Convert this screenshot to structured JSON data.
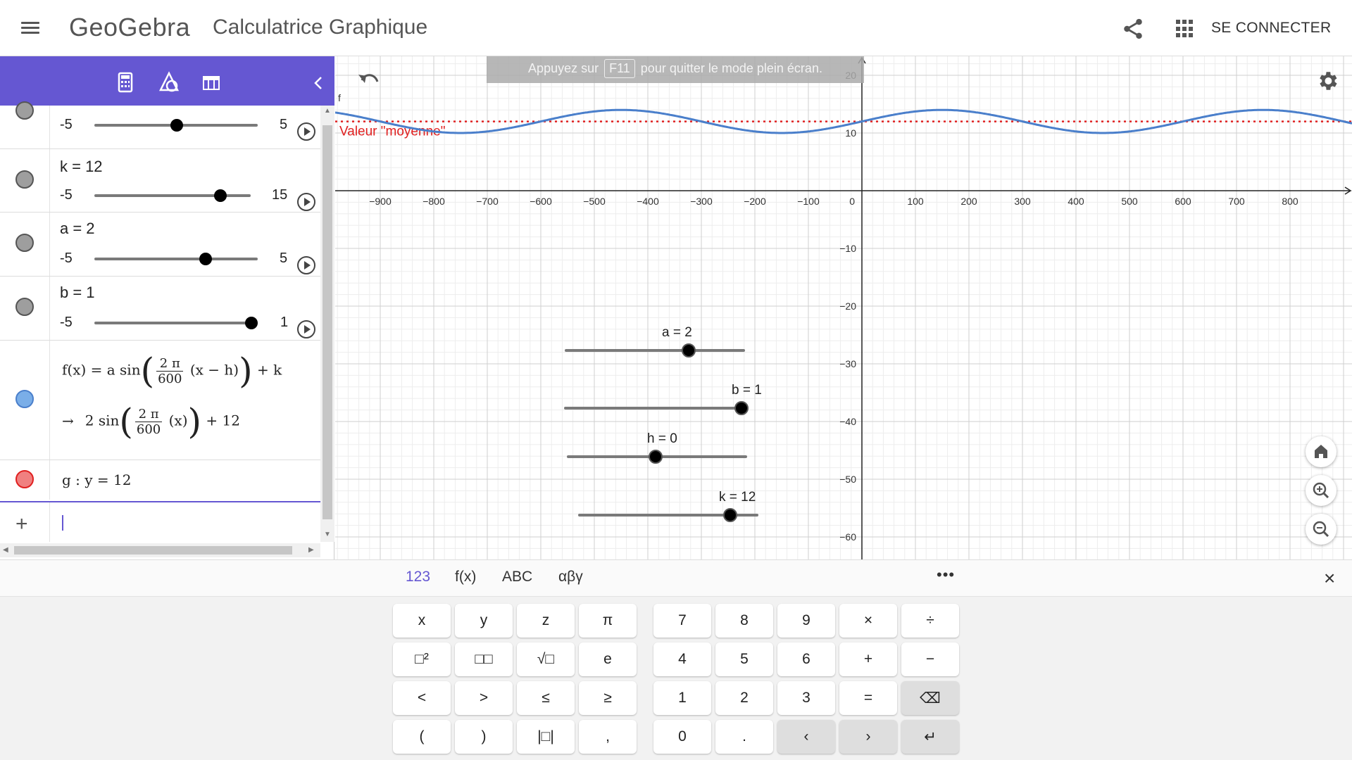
{
  "header": {
    "logo": "GeoGebra",
    "app_title": "Calculatrice Graphique",
    "login_label": "SE CONNECTER"
  },
  "fullscreen_notice": {
    "before": "Appuyez sur",
    "key": "F11",
    "after": "pour quitter le mode plein écran."
  },
  "algebra": {
    "rows": [
      {
        "label": "",
        "min": "-5",
        "max": "5",
        "value": 0,
        "color": "#9e9e9e"
      },
      {
        "label": "k = 12",
        "min": "-5",
        "max": "15",
        "value": 12,
        "color": "#9e9e9e"
      },
      {
        "label": "a = 2",
        "min": "-5",
        "max": "5",
        "value": 2,
        "color": "#9e9e9e"
      },
      {
        "label": "b = 1",
        "min": "-5",
        "max": "1",
        "value": 1,
        "color": "#9e9e9e"
      }
    ],
    "function_row": {
      "lhs": "f(x) = a  sin",
      "frac_num": "2 π",
      "frac_den": "600",
      "args": "(x − h)",
      "tail": "+ k",
      "arrow": "→",
      "result_pre": "2  sin",
      "result_args": "(x)",
      "result_tail": "+ 12",
      "color": "#7aaee8"
    },
    "line_row": {
      "text": "g : y = 12",
      "color": "#f08080"
    }
  },
  "graph": {
    "x_ticks": [
      -900,
      -800,
      -700,
      -600,
      -500,
      -400,
      -300,
      -200,
      -100,
      100,
      200,
      300,
      400,
      500,
      600,
      700,
      800
    ],
    "y_ticks": [
      20,
      10,
      -10,
      -20,
      -30,
      -40,
      -50,
      -60
    ],
    "origin_label": "0",
    "f_label": "f",
    "g_label": "Valeur \"moyenne\"",
    "function": {
      "a": 2,
      "b": 1,
      "h": 0,
      "k": 12,
      "period": 600
    },
    "line_y": 12,
    "colors": {
      "function": "#4a7fcb",
      "line": "#e02020"
    },
    "sliders": [
      {
        "label": "a = 2",
        "value": 2,
        "min": -5,
        "max": 5
      },
      {
        "label": "b = 1",
        "value": 1,
        "min": -5,
        "max": 1
      },
      {
        "label": "h = 0",
        "value": 0,
        "min": -5,
        "max": 5
      },
      {
        "label": "k = 12",
        "value": 12,
        "min": -5,
        "max": 15
      }
    ]
  },
  "keyboard": {
    "tabs": [
      "123",
      "f(x)",
      "ABC",
      "αβγ"
    ],
    "more": "•••",
    "close": "×",
    "left_keys": [
      [
        "x",
        "y",
        "z",
        "π"
      ],
      [
        "□²",
        "□□",
        "√□",
        "e"
      ],
      [
        "<",
        ">",
        "≤",
        "≥"
      ],
      [
        "(",
        ")",
        "|□|",
        ","
      ]
    ],
    "right_keys": [
      [
        "7",
        "8",
        "9",
        "×",
        "÷"
      ],
      [
        "4",
        "5",
        "6",
        "+",
        "−"
      ],
      [
        "1",
        "2",
        "3",
        "=",
        "⌫"
      ],
      [
        "0",
        ".",
        "‹",
        "›",
        "↵"
      ]
    ]
  },
  "accent_color": "#6557d2"
}
